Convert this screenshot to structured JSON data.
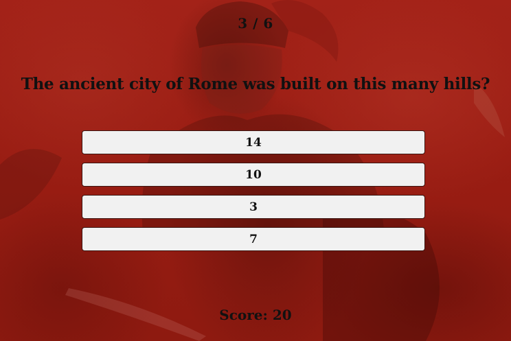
{
  "quiz": {
    "counter": "3 / 6",
    "question": "The ancient city of Rome was built on this many hills?",
    "answers": [
      "14",
      "10",
      "3",
      "7"
    ],
    "score": "Score: 20"
  },
  "background": {
    "image": "roman-soldier-red-tinted",
    "tint_color": "#a0200f"
  }
}
